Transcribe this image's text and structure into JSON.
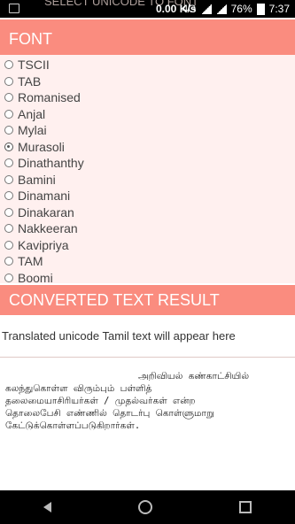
{
  "status_bar": {
    "overlay_text": "SELECT UNICODE TO FONT",
    "speed": "0.00 K/s",
    "network": "4G",
    "battery": "76%",
    "time": "7:37"
  },
  "font_section": {
    "title": "FONT",
    "options": [
      "TSCII",
      "TAB",
      "Romanised",
      "Anjal",
      "Mylai",
      "Murasoli",
      "Dinathanthy",
      "Bamini",
      "Dinamani",
      "Dinakaran",
      "Nakkeeran",
      "Kavipriya",
      "TAM",
      "Boomi"
    ],
    "selected": "Murasoli"
  },
  "result_section": {
    "title": "CONVERTED TEXT RESULT",
    "hint": "Translated unicode Tamil text will appear here",
    "output_lines": [
      "அறிவியல் கண்காட்சியில்",
      "கலந்துகொள்ள விரும்பும் பள்ளித்",
      "தலைமையாசிரியர்கள் / முதல்வர்கள் என்ற",
      "தொலைபேசி எண்ணில் தொடர்பு கொள்ளுமாறு",
      "கேட்டுக்கொள்ளப்படுகிறார்கள்."
    ]
  }
}
